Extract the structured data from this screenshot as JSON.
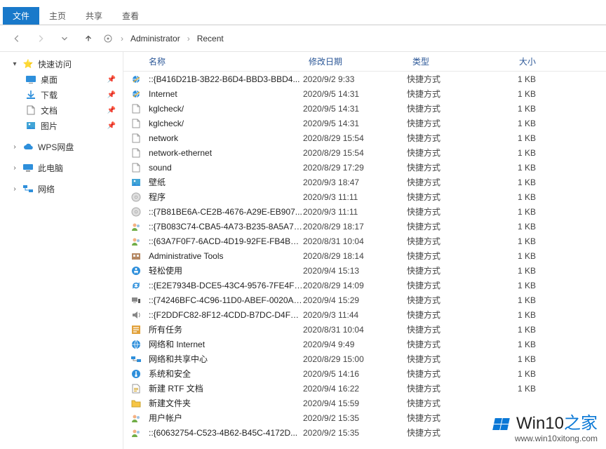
{
  "tabs": {
    "file": "文件",
    "home": "主页",
    "share": "共享",
    "view": "查看"
  },
  "breadcrumb": {
    "user": "Administrator",
    "folder": "Recent"
  },
  "sidebar": {
    "quick": "快速访问",
    "desktop": "桌面",
    "downloads": "下载",
    "documents": "文档",
    "pictures": "图片",
    "wps": "WPS网盘",
    "thispc": "此电脑",
    "network": "网络"
  },
  "columns": {
    "name": "名称",
    "date": "修改日期",
    "type": "类型",
    "size": "大小"
  },
  "rows": [
    {
      "icon": "ie",
      "name": "::{B416D21B-3B22-B6D4-BBD3-BBD4...",
      "date": "2020/9/2 9:33",
      "type": "快捷方式",
      "size": "1 KB"
    },
    {
      "icon": "ie",
      "name": "Internet",
      "date": "2020/9/5 14:31",
      "type": "快捷方式",
      "size": "1 KB"
    },
    {
      "icon": "file",
      "name": "kglcheck/",
      "date": "2020/9/5 14:31",
      "type": "快捷方式",
      "size": "1 KB"
    },
    {
      "icon": "file",
      "name": "kglcheck/",
      "date": "2020/9/5 14:31",
      "type": "快捷方式",
      "size": "1 KB"
    },
    {
      "icon": "file",
      "name": "network",
      "date": "2020/8/29 15:54",
      "type": "快捷方式",
      "size": "1 KB"
    },
    {
      "icon": "file",
      "name": "network-ethernet",
      "date": "2020/8/29 15:54",
      "type": "快捷方式",
      "size": "1 KB"
    },
    {
      "icon": "file",
      "name": "sound",
      "date": "2020/8/29 17:29",
      "type": "快捷方式",
      "size": "1 KB"
    },
    {
      "icon": "img",
      "name": "壁纸",
      "date": "2020/9/3 18:47",
      "type": "快捷方式",
      "size": "1 KB"
    },
    {
      "icon": "disc",
      "name": "程序",
      "date": "2020/9/3 11:11",
      "type": "快捷方式",
      "size": "1 KB"
    },
    {
      "icon": "disc",
      "name": "::{7B81BE6A-CE2B-4676-A29E-EB907...",
      "date": "2020/9/3 11:11",
      "type": "快捷方式",
      "size": "1 KB"
    },
    {
      "icon": "users",
      "name": "::{7B083C74-CBA5-4A73-B235-8A5A71...",
      "date": "2020/8/29 18:17",
      "type": "快捷方式",
      "size": "1 KB"
    },
    {
      "icon": "users",
      "name": "::{63A7F0F7-6ACD-4D19-92FE-FB4BD9...",
      "date": "2020/8/31 10:04",
      "type": "快捷方式",
      "size": "1 KB"
    },
    {
      "icon": "admin",
      "name": "Administrative Tools",
      "date": "2020/8/29 18:14",
      "type": "快捷方式",
      "size": "1 KB"
    },
    {
      "icon": "ease",
      "name": "轻松使用",
      "date": "2020/9/4 15:13",
      "type": "快捷方式",
      "size": "1 KB"
    },
    {
      "icon": "sync",
      "name": "::{E2E7934B-DCE5-43C4-9576-7FE4F7...",
      "date": "2020/8/29 14:09",
      "type": "快捷方式",
      "size": "1 KB"
    },
    {
      "icon": "device",
      "name": "::{74246BFC-4C96-11D0-ABEF-0020AF...",
      "date": "2020/9/4 15:29",
      "type": "快捷方式",
      "size": "1 KB"
    },
    {
      "icon": "sound",
      "name": "::{F2DDFC82-8F12-4CDD-B7DC-D4FE1...",
      "date": "2020/9/3 11:44",
      "type": "快捷方式",
      "size": "1 KB"
    },
    {
      "icon": "tasks",
      "name": "所有任务",
      "date": "2020/8/31 10:04",
      "type": "快捷方式",
      "size": "1 KB"
    },
    {
      "icon": "net",
      "name": "网络和 Internet",
      "date": "2020/9/4 9:49",
      "type": "快捷方式",
      "size": "1 KB"
    },
    {
      "icon": "netsh",
      "name": "网络和共享中心",
      "date": "2020/8/29 15:00",
      "type": "快捷方式",
      "size": "1 KB"
    },
    {
      "icon": "sec",
      "name": "系统和安全",
      "date": "2020/9/5 14:16",
      "type": "快捷方式",
      "size": "1 KB"
    },
    {
      "icon": "rtf",
      "name": "新建 RTF 文档",
      "date": "2020/9/4 16:22",
      "type": "快捷方式",
      "size": "1 KB"
    },
    {
      "icon": "folder",
      "name": "新建文件夹",
      "date": "2020/9/4 15:59",
      "type": "快捷方式",
      "size": ""
    },
    {
      "icon": "users",
      "name": "用户帐户",
      "date": "2020/9/2 15:35",
      "type": "快捷方式",
      "size": ""
    },
    {
      "icon": "users",
      "name": "::{60632754-C523-4B62-B45C-4172D...",
      "date": "2020/9/2 15:35",
      "type": "快捷方式",
      "size": ""
    }
  ],
  "watermark": {
    "brand_pre": "Win10",
    "brand_post": "之家",
    "url": "www.win10xitong.com"
  }
}
